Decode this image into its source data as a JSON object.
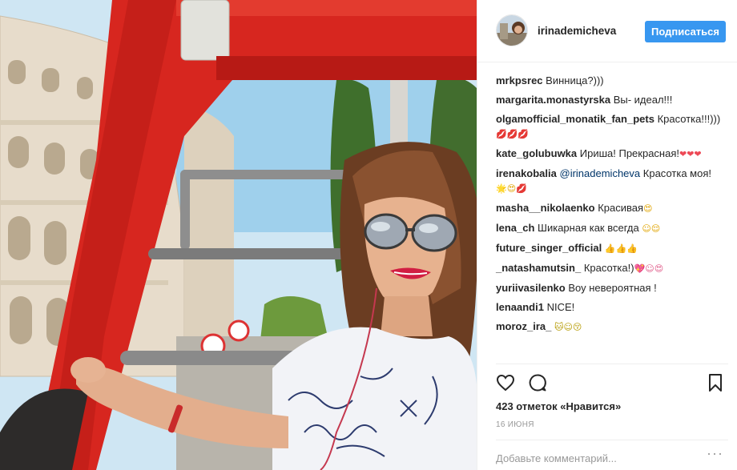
{
  "post": {
    "username": "irinademicheva",
    "follow_label": "Подписаться",
    "likes_text": "423 отметок «Нравится»",
    "date": "16 ИЮНЯ",
    "comment_placeholder": "Добавьте комментарий...",
    "more_label": "···"
  },
  "comments": [
    {
      "user": "mrkpsrec",
      "text": "Винница?)))"
    },
    {
      "user": "margarita.monastyrska",
      "text": "Вы- идеал!!!"
    },
    {
      "user": "olgamofficial_monatik_fan_pets",
      "text": "Красотка!!!)))",
      "emoji": "💋💋💋"
    },
    {
      "user": "kate_golubuwka",
      "text": "Ириша! Прекрасная!",
      "emoji": "❤❤❤"
    },
    {
      "user": "irenakobalia",
      "mention": "@irinademicheva",
      "text": "Красотка моя!",
      "emoji": "🌟😍💋"
    },
    {
      "user": "masha__nikolaenko",
      "text": "Красивая",
      "emoji": "😍"
    },
    {
      "user": "lena_ch",
      "text": "Шикарная как всегда",
      "emoji": "☺😌"
    },
    {
      "user": "future_singer_official",
      "text": "",
      "emoji": "👍👍👍"
    },
    {
      "user": "_natashamutsin_",
      "text": "Красотка!)",
      "emoji": "💖☺😍"
    },
    {
      "user": "yuriivasilenko",
      "text": "Воу невероятная !"
    },
    {
      "user": "lenaandi1",
      "text": "NICE!"
    },
    {
      "user": "moroz_ira_",
      "text": "",
      "emoji": "🐱☺😚"
    }
  ],
  "colors": {
    "follow_button": "#3897f0",
    "text": "#262626",
    "mention": "#003569",
    "muted": "#999999",
    "heart": "#ed4956"
  },
  "icons": [
    "heart-icon",
    "comment-icon",
    "bookmark-icon"
  ]
}
